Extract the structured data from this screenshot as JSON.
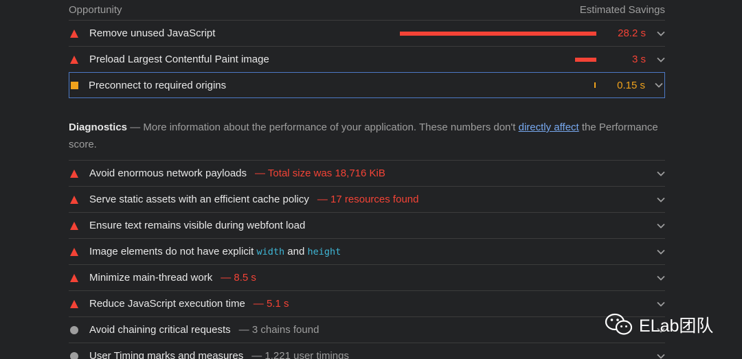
{
  "header": {
    "left": "Opportunity",
    "right": "Estimated Savings"
  },
  "opportunities": [
    {
      "title": "Remove unused JavaScript",
      "savings": "28.2 s",
      "severity": "fail",
      "bar_fraction": 1.0
    },
    {
      "title": "Preload Largest Contentful Paint image",
      "savings": "3 s",
      "severity": "fail",
      "bar_fraction": 0.11
    },
    {
      "title": "Preconnect to required origins",
      "savings": "0.15 s",
      "severity": "average",
      "bar_fraction": 0.01
    }
  ],
  "diagnostics": {
    "title": "Diagnostics",
    "dash": "—",
    "desc_before": "More information about the performance of your application. These numbers don't",
    "link": "directly affect",
    "desc_after": "the Performance score."
  },
  "audits": [
    {
      "title": "Avoid enormous network payloads",
      "detail": "— Total size was 18,716 KiB",
      "severity": "fail"
    },
    {
      "title": "Serve static assets with an efficient cache policy",
      "detail": "— 17 resources found",
      "severity": "fail"
    },
    {
      "title": "Ensure text remains visible during webfont load",
      "detail": "",
      "severity": "fail"
    },
    {
      "title_before": "Image elements do not have explicit",
      "code1": "width",
      "mid": "and",
      "code2": "height",
      "severity": "fail"
    },
    {
      "title": "Minimize main-thread work",
      "detail": "— 8.5 s",
      "severity": "fail"
    },
    {
      "title": "Reduce JavaScript execution time",
      "detail": "— 5.1 s",
      "severity": "fail"
    },
    {
      "title": "Avoid chaining critical requests",
      "detail": "— 3 chains found",
      "severity": "info"
    },
    {
      "title": "User Timing marks and measures",
      "detail": "— 1,221 user timings",
      "severity": "info"
    }
  ],
  "watermark": {
    "text": "ELab团队"
  },
  "colors": {
    "fail": "#f44336",
    "average": "#f0a21c",
    "info": "#9e9e9e",
    "link": "#78a9f0",
    "code": "#3fb7d6",
    "focus": "#4d7ac7"
  }
}
